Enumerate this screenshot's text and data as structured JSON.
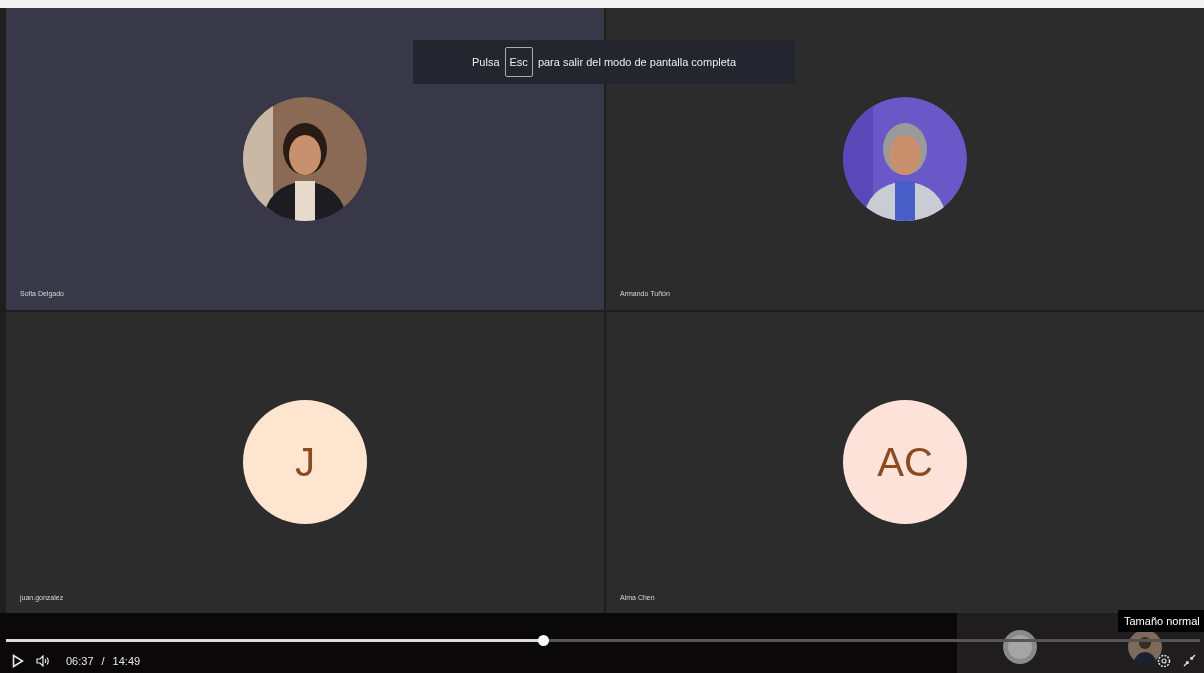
{
  "fullscreen_hint": {
    "before": "Pulsa",
    "key": "Esc",
    "after": "para salir del modo de pantalla completa"
  },
  "participants": [
    {
      "name": "Sofia Delgado",
      "selected": true
    },
    {
      "name": "Armando Tuñón",
      "selected": false
    },
    {
      "name": "juan.gonzalez",
      "kind": "initials",
      "initials": "J",
      "color": "#fde5cf",
      "selected": false
    },
    {
      "name": "Alma Chen",
      "kind": "initials",
      "initials": "AC",
      "color": "#fde2da",
      "selected": false
    }
  ],
  "player": {
    "level": 0.45,
    "time": "06:37",
    "separator": "/",
    "duration": "14:49",
    "tooltip": "Tamaño normal"
  }
}
